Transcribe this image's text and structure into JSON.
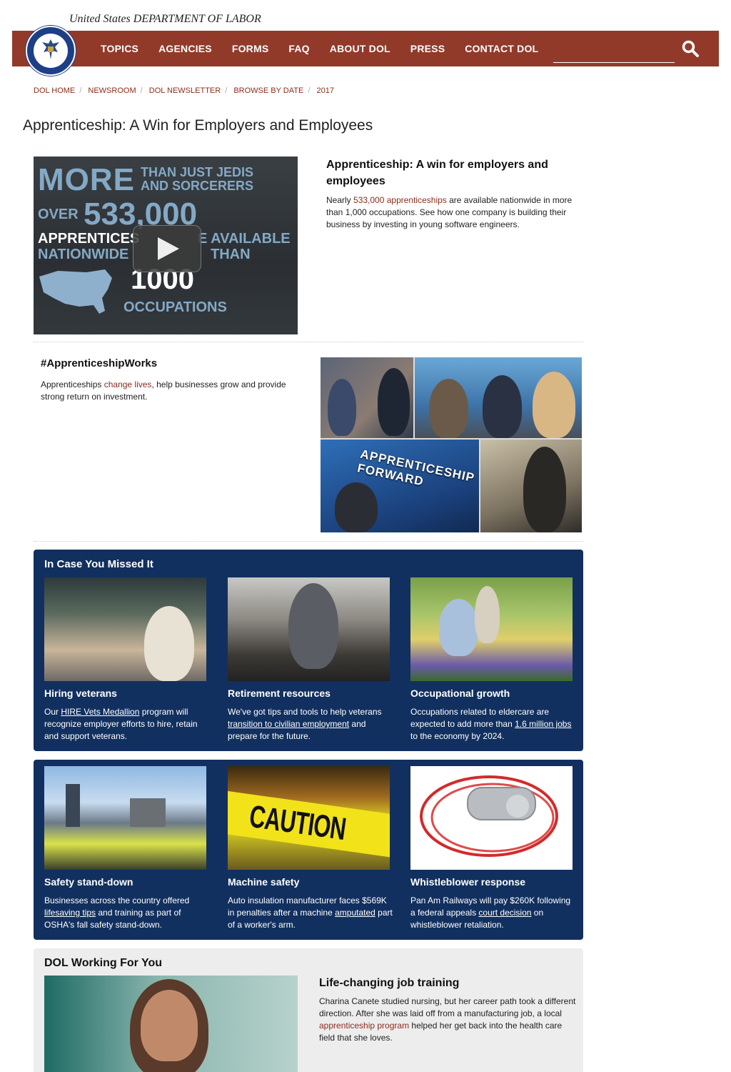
{
  "header": {
    "department_title": "United States DEPARTMENT OF LABOR",
    "nav": [
      "TOPICS",
      "AGENCIES",
      "FORMS",
      "FAQ",
      "ABOUT DOL",
      "PRESS",
      "CONTACT DOL"
    ],
    "search_placeholder": ""
  },
  "breadcrumb": [
    "DOL HOME",
    "NEWSROOM",
    "DOL NEWSLETTER",
    "BROWSE BY DATE",
    "2017"
  ],
  "page_title": "Apprenticeship: A Win for Employers and Employees",
  "video": {
    "line1_big": "MORE",
    "line1_small_a": "THAN JUST JEDIS",
    "line1_small_b": "AND SORCERERS",
    "over": "OVER",
    "number": "533,000",
    "apprentices": "APPRENTICES",
    "available": "E AVAILABLE",
    "nationwide": "NATIONWIDE",
    "than": "THAN",
    "thousand": "1000",
    "occupations": "OCCUPATIONS"
  },
  "feature": {
    "title": "Apprenticeship: A win for employers and employees",
    "body_pre": "Nearly ",
    "body_link": "533,000 apprenticeships",
    "body_post": " are available nationwide in more than 1,000 occupations. See how one company is building their business by investing in young software engineers."
  },
  "hashtag": {
    "title": "#ApprenticeshipWorks",
    "body_pre": "Apprenticeships ",
    "body_link": "change lives",
    "body_post": ", help businesses grow and provide strong return on investment.",
    "sign_text": "APPRENTICESHIP FORWARD"
  },
  "icymi": {
    "title": "In Case You Missed It",
    "cards": [
      {
        "title": "Hiring veterans",
        "pre": "Our ",
        "link": "HIRE Vets Medallion",
        "post": " program will recognize employer efforts to hire, retain and support veterans."
      },
      {
        "title": "Retirement resources",
        "pre": "We've got tips and tools to help veterans ",
        "link": "transition to civilian employment",
        "post": " and prepare for the future."
      },
      {
        "title": "Occupational growth",
        "pre": "Occupations related to eldercare are expected to add more than ",
        "link": "1.6 million jobs",
        "post": " to the economy by 2024."
      },
      {
        "title": "Safety stand-down",
        "pre": "Businesses across the country offered ",
        "link": "lifesaving tips",
        "post": " and training as part of OSHA's fall safety stand-down."
      },
      {
        "title": "Machine safety",
        "pre": "Auto insulation manufacturer faces $569K in penalties after a machine ",
        "link": "amputated",
        "post": " part of a worker's arm."
      },
      {
        "title": "Whistleblower response",
        "pre": "Pan Am Railways will pay $260K following a federal appeals ",
        "link": "court decision",
        "post": " on whistleblower retaliation."
      }
    ],
    "caution_text": "CAUTION"
  },
  "dol_working": {
    "title": "DOL Working For You",
    "headline": "Life-changing job training",
    "body_pre": "Charina Canete studied nursing, but her career path took a different direction. After she was laid off from a manufacturing job, a local ",
    "body_link": "apprenticeship program",
    "body_post": " helped her get back into the health care field that she loves."
  },
  "colors": {
    "brand_red": "#923a2a",
    "panel_navy": "#12305f",
    "link": "#8a2d1f"
  }
}
